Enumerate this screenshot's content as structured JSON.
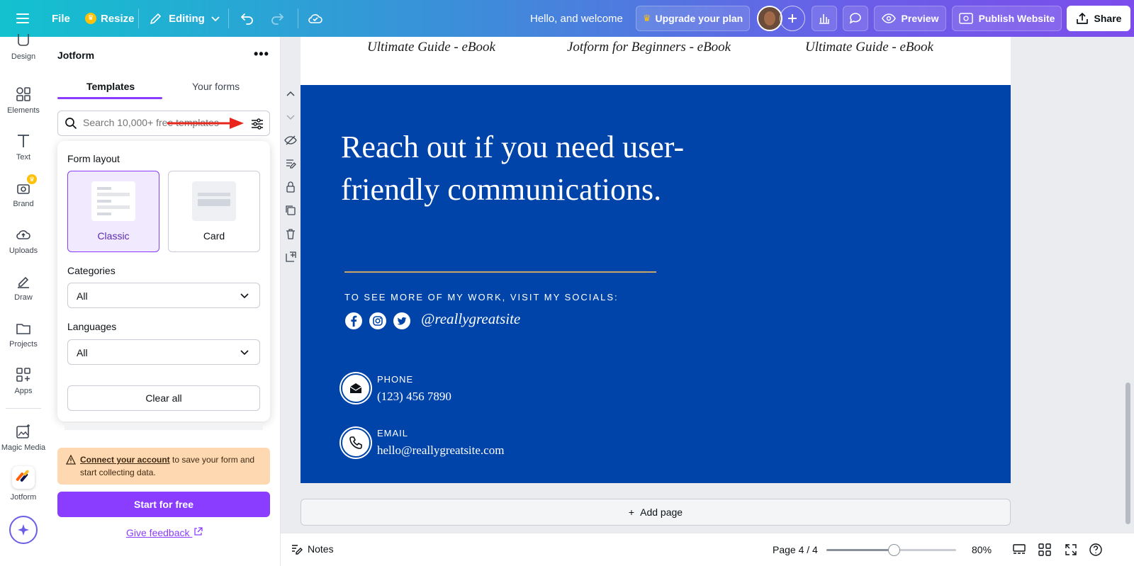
{
  "topbar": {
    "file": "File",
    "resize": "Resize",
    "editing": "Editing",
    "welcome": "Hello, and welcome",
    "upgrade": "Upgrade your plan",
    "preview": "Preview",
    "publish": "Publish Website",
    "share": "Share"
  },
  "rail": {
    "items": [
      "Design",
      "Elements",
      "Text",
      "Brand",
      "Uploads",
      "Draw",
      "Projects",
      "Apps",
      "Magic Media",
      "Jotform"
    ]
  },
  "panel": {
    "title": "Jotform",
    "tabs": [
      "Templates",
      "Your forms"
    ],
    "search_placeholder": "Search 10,000+ free templates",
    "filters": {
      "layout_label": "Form layout",
      "layouts": [
        "Classic",
        "Card"
      ],
      "selected_layout": "Classic",
      "categories_label": "Categories",
      "categories_value": "All",
      "languages_label": "Languages",
      "languages_value": "All",
      "clear_label": "Clear all"
    },
    "warning_link": "Connect your account",
    "warning_text": " to save your form and start collecting data.",
    "start_label": "Start for free",
    "feedback_label": "Give feedback"
  },
  "design": {
    "ebooks": [
      "Ultimate Guide - eBook",
      "Jotform for Beginners - eBook",
      "Ultimate Guide - eBook"
    ],
    "headline": "Reach out if you need user-friendly communications.",
    "socials_text": "TO SEE MORE OF MY WORK, VISIT MY SOCIALS:",
    "handle": "@reallygreatsite",
    "phone_label": "PHONE",
    "phone_value": "(123) 456 7890",
    "email_label": "EMAIL",
    "email_value": "hello@reallygreatsite.com",
    "colors": {
      "page_bg": "#0044aa",
      "accent_line": "#c9a46a",
      "brand_purple": "#8b3dff"
    }
  },
  "canvas": {
    "add_page": "Add page"
  },
  "footer": {
    "notes": "Notes",
    "page": "Page 4 / 4",
    "zoom": "80%",
    "zoom_level": 0.52
  }
}
